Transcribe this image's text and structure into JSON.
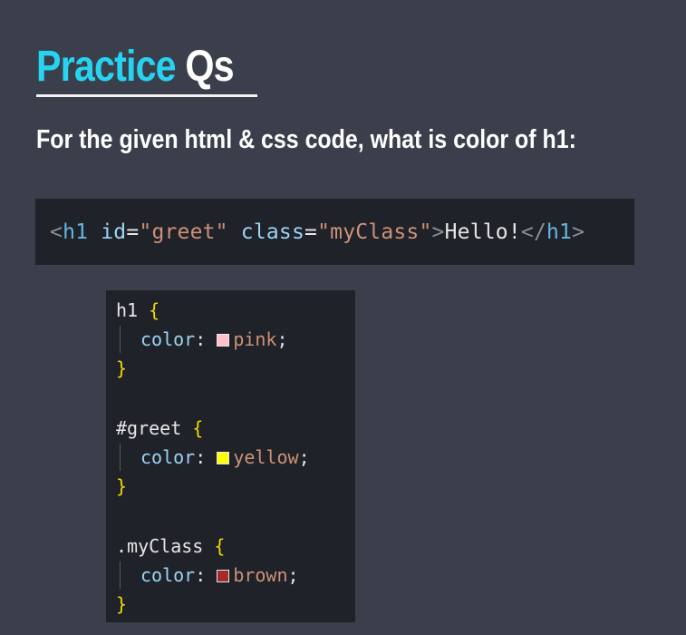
{
  "title": {
    "word1": "Practice",
    "word2": " Qs"
  },
  "question": "For the given html & css code, what is color of h1:",
  "html_snippet": {
    "open_bracket": "<",
    "tag": "h1",
    "attr1": " id",
    "eq1": "=",
    "val1": "\"greet\"",
    "attr2": " class",
    "eq2": "=",
    "val2": "\"myClass\"",
    "close_bracket": ">",
    "content": "Hello!",
    "end_open": "</",
    "end_tag": "h1",
    "end_close": ">"
  },
  "css_rules": [
    {
      "selector": "h1",
      "property": "color",
      "value": "pink",
      "swatch_color": "#ffc0cb"
    },
    {
      "selector": "#greet",
      "property": "color",
      "value": "yellow",
      "swatch_color": "#ffff00"
    },
    {
      "selector": ".myClass",
      "property": "color",
      "value": "brown",
      "swatch_color": "#a52a2a"
    }
  ],
  "syntax": {
    "brace_open": " {",
    "brace_close": "}",
    "colon": ":",
    "semicolon": ";"
  },
  "colors": {
    "background": "#3a3f4b",
    "accent": "#26d3f0",
    "code_bg": "#1f2228"
  }
}
